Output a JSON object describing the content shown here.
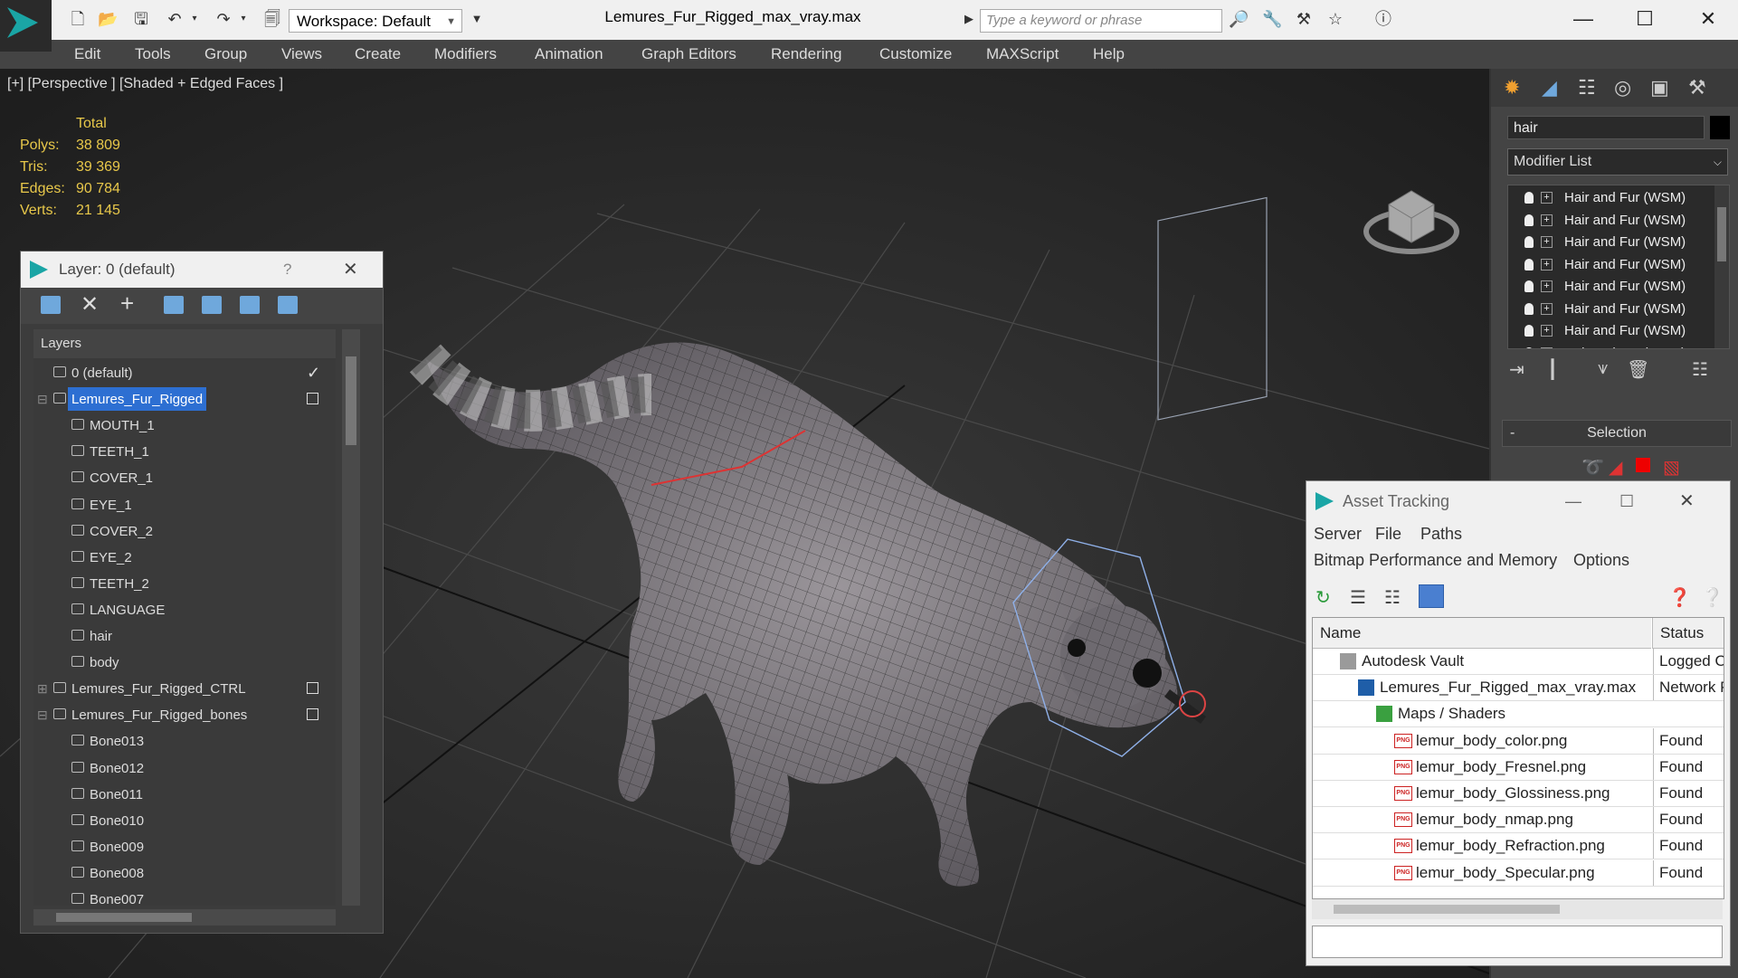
{
  "titlebar": {
    "workspace_label": "Workspace: Default",
    "file_title": "Lemures_Fur_Rigged_max_vray.max",
    "search_placeholder": "Type a keyword or phrase"
  },
  "menubar": [
    "Edit",
    "Tools",
    "Group",
    "Views",
    "Create",
    "Modifiers",
    "Animation",
    "Graph Editors",
    "Rendering",
    "Customize",
    "MAXScript",
    "Help"
  ],
  "viewport": {
    "label": "[+] [Perspective ] [Shaded + Edged Faces ]",
    "stats": {
      "header": "Total",
      "rows": [
        {
          "k": "Polys:",
          "v": "38 809"
        },
        {
          "k": "Tris:",
          "v": "39 369"
        },
        {
          "k": "Edges:",
          "v": "90 784"
        },
        {
          "k": "Verts:",
          "v": "21 145"
        }
      ]
    }
  },
  "layer_panel": {
    "title": "Layer: 0 (default)",
    "help": "?",
    "list_header": "Layers",
    "rows": [
      {
        "name": "0 (default)",
        "level": 0,
        "type": "layer",
        "check": "tick"
      },
      {
        "name": "Lemures_Fur_Rigged",
        "level": 0,
        "type": "layer",
        "check": "box",
        "selected": true,
        "expand": "-"
      },
      {
        "name": "MOUTH_1",
        "level": 1,
        "type": "obj"
      },
      {
        "name": "TEETH_1",
        "level": 1,
        "type": "obj"
      },
      {
        "name": "COVER_1",
        "level": 1,
        "type": "obj"
      },
      {
        "name": "EYE_1",
        "level": 1,
        "type": "obj"
      },
      {
        "name": "COVER_2",
        "level": 1,
        "type": "obj"
      },
      {
        "name": "EYE_2",
        "level": 1,
        "type": "obj"
      },
      {
        "name": "TEETH_2",
        "level": 1,
        "type": "obj"
      },
      {
        "name": "LANGUAGE",
        "level": 1,
        "type": "obj"
      },
      {
        "name": "hair",
        "level": 1,
        "type": "obj"
      },
      {
        "name": "body",
        "level": 1,
        "type": "obj"
      },
      {
        "name": "Lemures_Fur_Rigged_CTRL",
        "level": 0,
        "type": "layer",
        "check": "box",
        "expand": "+"
      },
      {
        "name": "Lemures_Fur_Rigged_bones",
        "level": 0,
        "type": "layer",
        "check": "box",
        "expand": "-"
      },
      {
        "name": "Bone013",
        "level": 1,
        "type": "obj"
      },
      {
        "name": "Bone012",
        "level": 1,
        "type": "obj"
      },
      {
        "name": "Bone011",
        "level": 1,
        "type": "obj"
      },
      {
        "name": "Bone010",
        "level": 1,
        "type": "obj"
      },
      {
        "name": "Bone009",
        "level": 1,
        "type": "obj"
      },
      {
        "name": "Bone008",
        "level": 1,
        "type": "obj"
      },
      {
        "name": "Bone007",
        "level": 1,
        "type": "obj"
      }
    ]
  },
  "command_panel": {
    "object_name": "hair",
    "modifier_list_label": "Modifier List",
    "stack": [
      "Hair and Fur (WSM)",
      "Hair and Fur (WSM)",
      "Hair and Fur (WSM)",
      "Hair and Fur (WSM)",
      "Hair and Fur (WSM)",
      "Hair and Fur (WSM)",
      "Hair and Fur (WSM)",
      "Hair and Fur (WSM)"
    ],
    "selection_label": "Selection",
    "selection_toggle": "-"
  },
  "asset_tracking": {
    "title": "Asset Tracking",
    "menu1": [
      "Server",
      "File",
      "Paths"
    ],
    "menu2": [
      "Bitmap Performance and Memory",
      "Options"
    ],
    "col_name": "Name",
    "col_status": "Status",
    "rows": [
      {
        "name": "Autodesk Vault",
        "status": "Logged O",
        "icon": "vault",
        "indent": 0
      },
      {
        "name": "Lemures_Fur_Rigged_max_vray.max",
        "status": "Network P",
        "icon": "max",
        "indent": 1
      },
      {
        "name": "Maps / Shaders",
        "status": "",
        "icon": "maps",
        "indent": 2
      },
      {
        "name": "lemur_body_color.png",
        "status": "Found",
        "icon": "png",
        "indent": 3
      },
      {
        "name": "lemur_body_Fresnel.png",
        "status": "Found",
        "icon": "png",
        "indent": 3
      },
      {
        "name": "lemur_body_Glossiness.png",
        "status": "Found",
        "icon": "png",
        "indent": 3
      },
      {
        "name": "lemur_body_nmap.png",
        "status": "Found",
        "icon": "png",
        "indent": 3
      },
      {
        "name": "lemur_body_Refraction.png",
        "status": "Found",
        "icon": "png",
        "indent": 3
      },
      {
        "name": "lemur_body_Specular.png",
        "status": "Found",
        "icon": "png",
        "indent": 3
      }
    ]
  },
  "colors": {
    "selection": "#2d6fd2",
    "stats": "#e8c84a",
    "accent": "#1aa5a5"
  }
}
